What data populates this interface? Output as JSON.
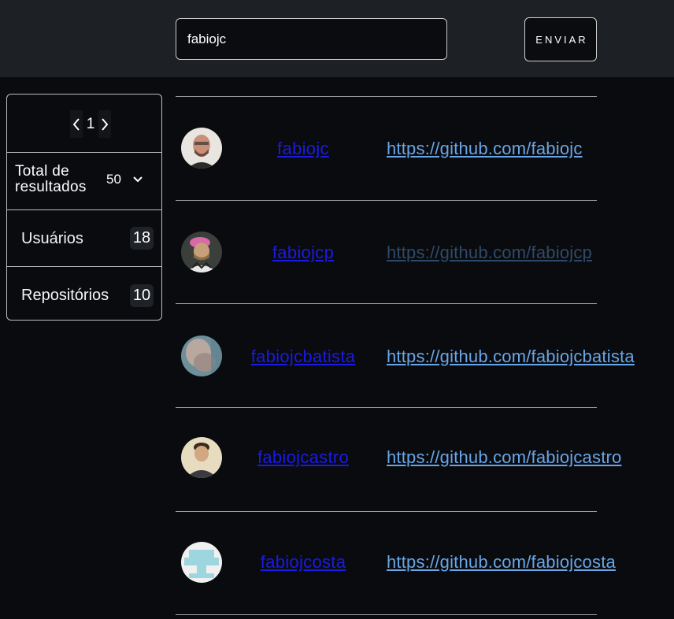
{
  "search": {
    "value": "fabiojc",
    "button_label": "ENVIAR"
  },
  "sidebar": {
    "pager": {
      "current_page": "1"
    },
    "total": {
      "label": "Total de resultados",
      "value": "50"
    },
    "items": [
      {
        "label": "Usuários",
        "count": "18"
      },
      {
        "label": "Repositórios",
        "count": "10"
      }
    ]
  },
  "results": [
    {
      "username": "fabiojc",
      "url": "https://github.com/fabiojc",
      "visited": false
    },
    {
      "username": "fabiojcp",
      "url": "https://github.com/fabiojcp",
      "visited": true
    },
    {
      "username": "fabiojcbatista",
      "url": "https://github.com/fabiojcbatista",
      "visited": false
    },
    {
      "username": "fabiojcastro",
      "url": "https://github.com/fabiojcastro",
      "visited": false
    },
    {
      "username": "fabiojcosta",
      "url": "https://github.com/fabiojcosta",
      "visited": false
    }
  ],
  "colors": {
    "username_link": "#1a1ae6",
    "url_link": "#68a6e8",
    "url_link_visited": "#2e4a6a",
    "topbar": "#1d2025",
    "background": "#0a0b0e"
  }
}
